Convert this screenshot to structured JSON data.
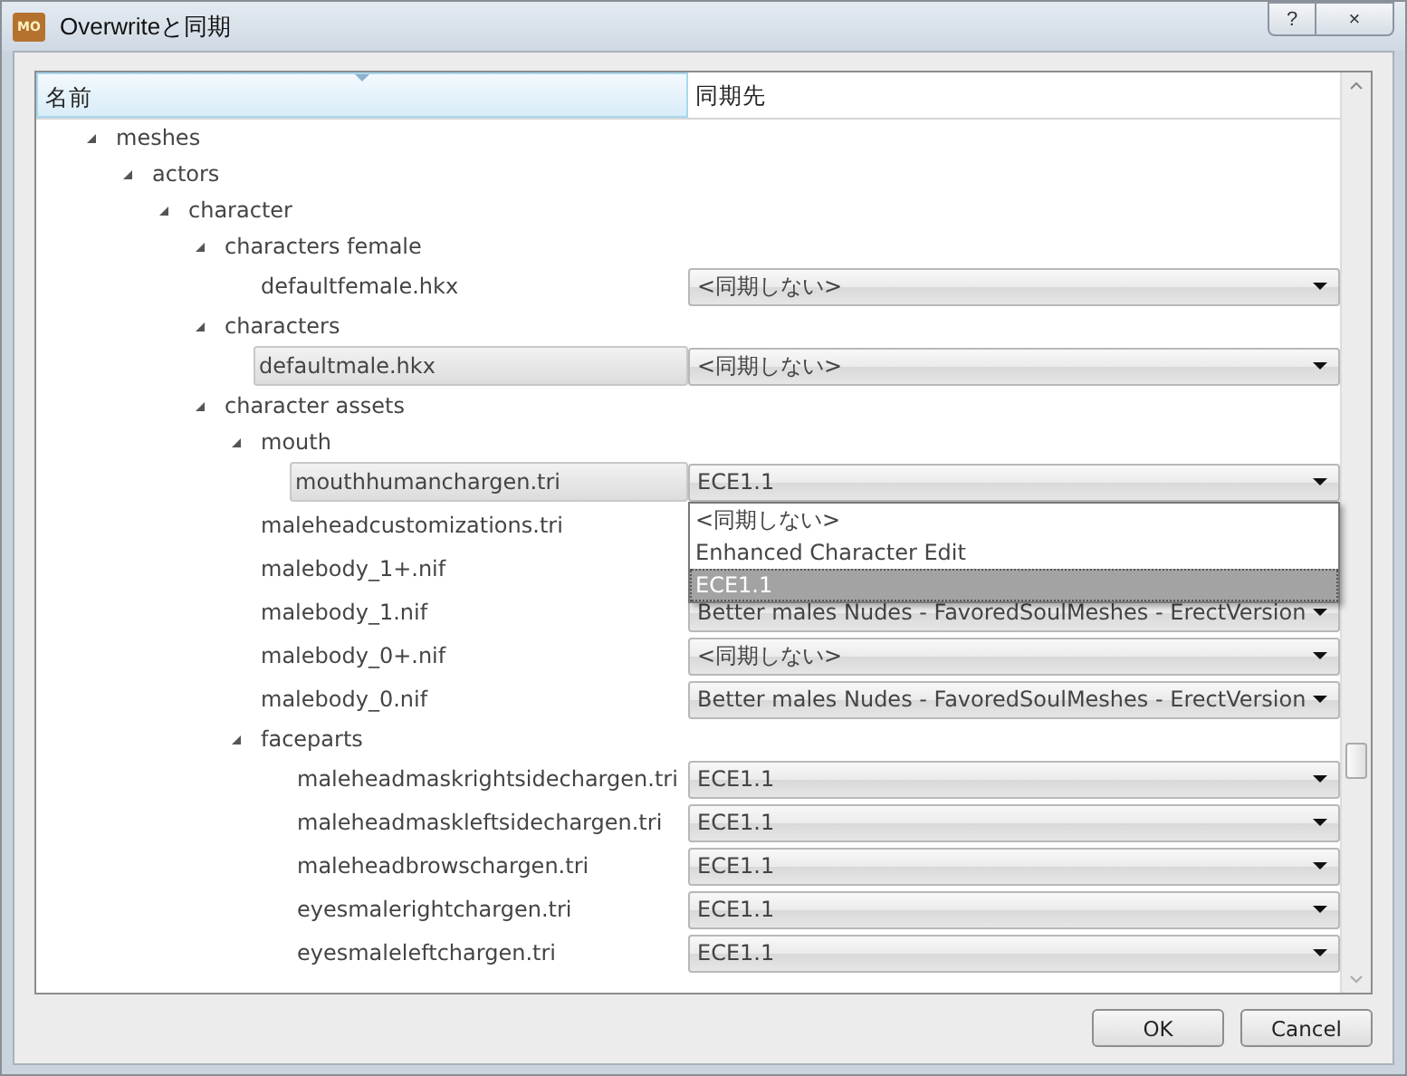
{
  "window": {
    "title": "Overwriteと同期",
    "icon_text": "MO",
    "help": "?",
    "close": "×"
  },
  "table": {
    "columns": [
      {
        "label": "名前",
        "sorted": true
      },
      {
        "label": "同期先",
        "sorted": false
      }
    ],
    "tree": [
      {
        "name": "meshes",
        "kind": "folder",
        "expanded": true,
        "selected": false,
        "children": [
          {
            "name": "actors",
            "kind": "folder",
            "expanded": true,
            "selected": false,
            "children": [
              {
                "name": "character",
                "kind": "folder",
                "expanded": true,
                "selected": false,
                "children": [
                  {
                    "name": "characters female",
                    "kind": "folder",
                    "expanded": true,
                    "selected": false,
                    "children": [
                      {
                        "name": "defaultfemale.hkx",
                        "kind": "file",
                        "selected": false,
                        "value": "<同期しない>"
                      }
                    ]
                  },
                  {
                    "name": "characters",
                    "kind": "folder",
                    "expanded": true,
                    "selected": false,
                    "children": [
                      {
                        "name": "defaultmale.hkx",
                        "kind": "file",
                        "selected": true,
                        "value": "<同期しない>"
                      }
                    ]
                  },
                  {
                    "name": "character assets",
                    "kind": "folder",
                    "expanded": true,
                    "selected": false,
                    "children": [
                      {
                        "name": "mouth",
                        "kind": "folder",
                        "expanded": true,
                        "selected": false,
                        "children": [
                          {
                            "name": "mouthhumanchargen.tri",
                            "kind": "file",
                            "selected": true,
                            "value": "ECE1.1",
                            "dropdown": [
                              {
                                "label": "<同期しない>",
                                "selected": false
                              },
                              {
                                "label": "Enhanced Character Edit",
                                "selected": false
                              },
                              {
                                "label": "ECE1.1",
                                "selected": true
                              }
                            ]
                          }
                        ]
                      },
                      {
                        "name": "maleheadcustomizations.tri",
                        "kind": "file",
                        "selected": false
                      },
                      {
                        "name": "malebody_1+.nif",
                        "kind": "file",
                        "selected": false
                      },
                      {
                        "name": "malebody_1.nif",
                        "kind": "file",
                        "selected": false,
                        "value": "Better males Nudes - FavoredSoulMeshes - ErectVersion"
                      },
                      {
                        "name": "malebody_0+.nif",
                        "kind": "file",
                        "selected": false,
                        "value": "<同期しない>"
                      },
                      {
                        "name": "malebody_0.nif",
                        "kind": "file",
                        "selected": false,
                        "value": "Better males Nudes - FavoredSoulMeshes - ErectVersion"
                      },
                      {
                        "name": "faceparts",
                        "kind": "folder",
                        "expanded": true,
                        "selected": false,
                        "children": [
                          {
                            "name": "maleheadmaskrightsidechargen.tri",
                            "kind": "file",
                            "selected": false,
                            "value": "ECE1.1"
                          },
                          {
                            "name": "maleheadmaskleftsidechargen.tri",
                            "kind": "file",
                            "selected": false,
                            "value": "ECE1.1"
                          },
                          {
                            "name": "maleheadbrowschargen.tri",
                            "kind": "file",
                            "selected": false,
                            "value": "ECE1.1"
                          },
                          {
                            "name": "eyesmalerightchargen.tri",
                            "kind": "file",
                            "selected": false,
                            "value": "ECE1.1"
                          },
                          {
                            "name": "eyesmaleleftchargen.tri",
                            "kind": "file",
                            "selected": false,
                            "value": "ECE1.1"
                          }
                        ]
                      }
                    ]
                  }
                ]
              }
            ]
          }
        ]
      }
    ]
  },
  "buttons": [
    {
      "label": "OK"
    },
    {
      "label": "Cancel"
    }
  ]
}
